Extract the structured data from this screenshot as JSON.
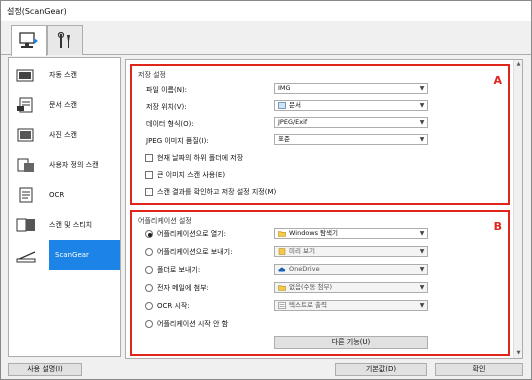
{
  "window": {
    "title": "설정(ScanGear)"
  },
  "tabs": [
    {
      "icon": "computer-scan-icon"
    },
    {
      "icon": "tools-icon"
    }
  ],
  "sidebar": {
    "items": [
      {
        "label": "자동 스캔",
        "icon": "auto-scan-icon"
      },
      {
        "label": "문서 스캔",
        "icon": "document-scan-icon"
      },
      {
        "label": "사진 스캔",
        "icon": "photo-scan-icon"
      },
      {
        "label": "사용자 정의 스캔",
        "icon": "custom-scan-icon"
      },
      {
        "label": "OCR",
        "icon": "ocr-icon"
      },
      {
        "label": "스캔 및 스티치",
        "icon": "stitch-icon"
      },
      {
        "label": "ScanGear",
        "icon": "scangear-icon"
      }
    ]
  },
  "save_settings": {
    "title": "저장 설정",
    "marker": "A",
    "file_name_label": "파일 이름(N):",
    "file_name_value": "IMG",
    "save_in_label": "저장 위치(V):",
    "save_in_value": "문서",
    "data_format_label": "데이터 형식(O):",
    "data_format_value": "JPEG/Exif",
    "jpeg_quality_label": "JPEG 이미지 품질(I):",
    "jpeg_quality_value": "표준",
    "cb_subfolder": "현재 날짜의 하위 폴더에 저장",
    "cb_large_image": "큰 이미지 스캔 사용(E)",
    "cb_check_results": "스캔 결과를 확인하고 저장 설정 지정(M)"
  },
  "app_settings": {
    "title": "어플리케이션 설정",
    "marker": "B",
    "radio_open_app": "어플리케이션으로 열기:",
    "radio_open_app_value": "Windows 탐색기",
    "radio_send_app": "어플리케이션으로 보내기:",
    "radio_send_app_value": "미리 보기",
    "radio_send_folder": "폴더로 보내기:",
    "radio_send_folder_value": "OneDrive",
    "radio_attach_email": "전자 메일에 첨부:",
    "radio_attach_email_value": "없음(수동 첨부)",
    "radio_start_ocr": "OCR 시작:",
    "radio_start_ocr_value": "텍스트로 출력",
    "radio_no_app": "어플리케이션 시작 안 함",
    "more_functions": "다른 기능(U)"
  },
  "footer": {
    "instructions": "사용 설명(I)",
    "defaults": "기본값(D)",
    "ok": "확인"
  }
}
